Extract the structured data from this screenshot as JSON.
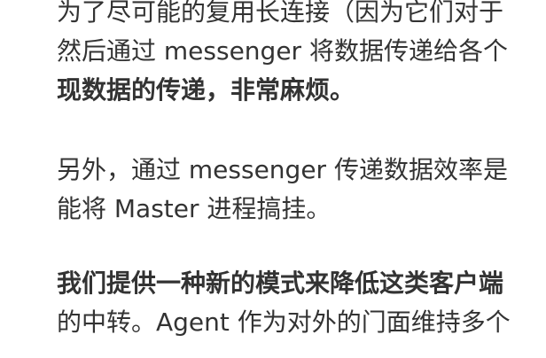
{
  "paragraphs": [
    {
      "lines": [
        {
          "text": "为了尽可能的复用长连接（因为它们对于",
          "bold": false
        },
        {
          "text": "然后通过 messenger 将数据传递给各个",
          "bold": false
        },
        {
          "text": "现数据的传递，非常麻烦。",
          "bold": true
        }
      ]
    },
    {
      "lines": [
        {
          "text": "另外，通过 messenger 传递数据效率是",
          "bold": false
        },
        {
          "text": "能将 Master 进程搞挂。",
          "bold": false
        }
      ]
    },
    {
      "lines": [
        {
          "text": "我们提供一种新的模式来降低这类客户端",
          "bold": true
        },
        {
          "text": "的中转。Agent 作为对外的门面维持多个",
          "bold": false
        }
      ]
    }
  ]
}
